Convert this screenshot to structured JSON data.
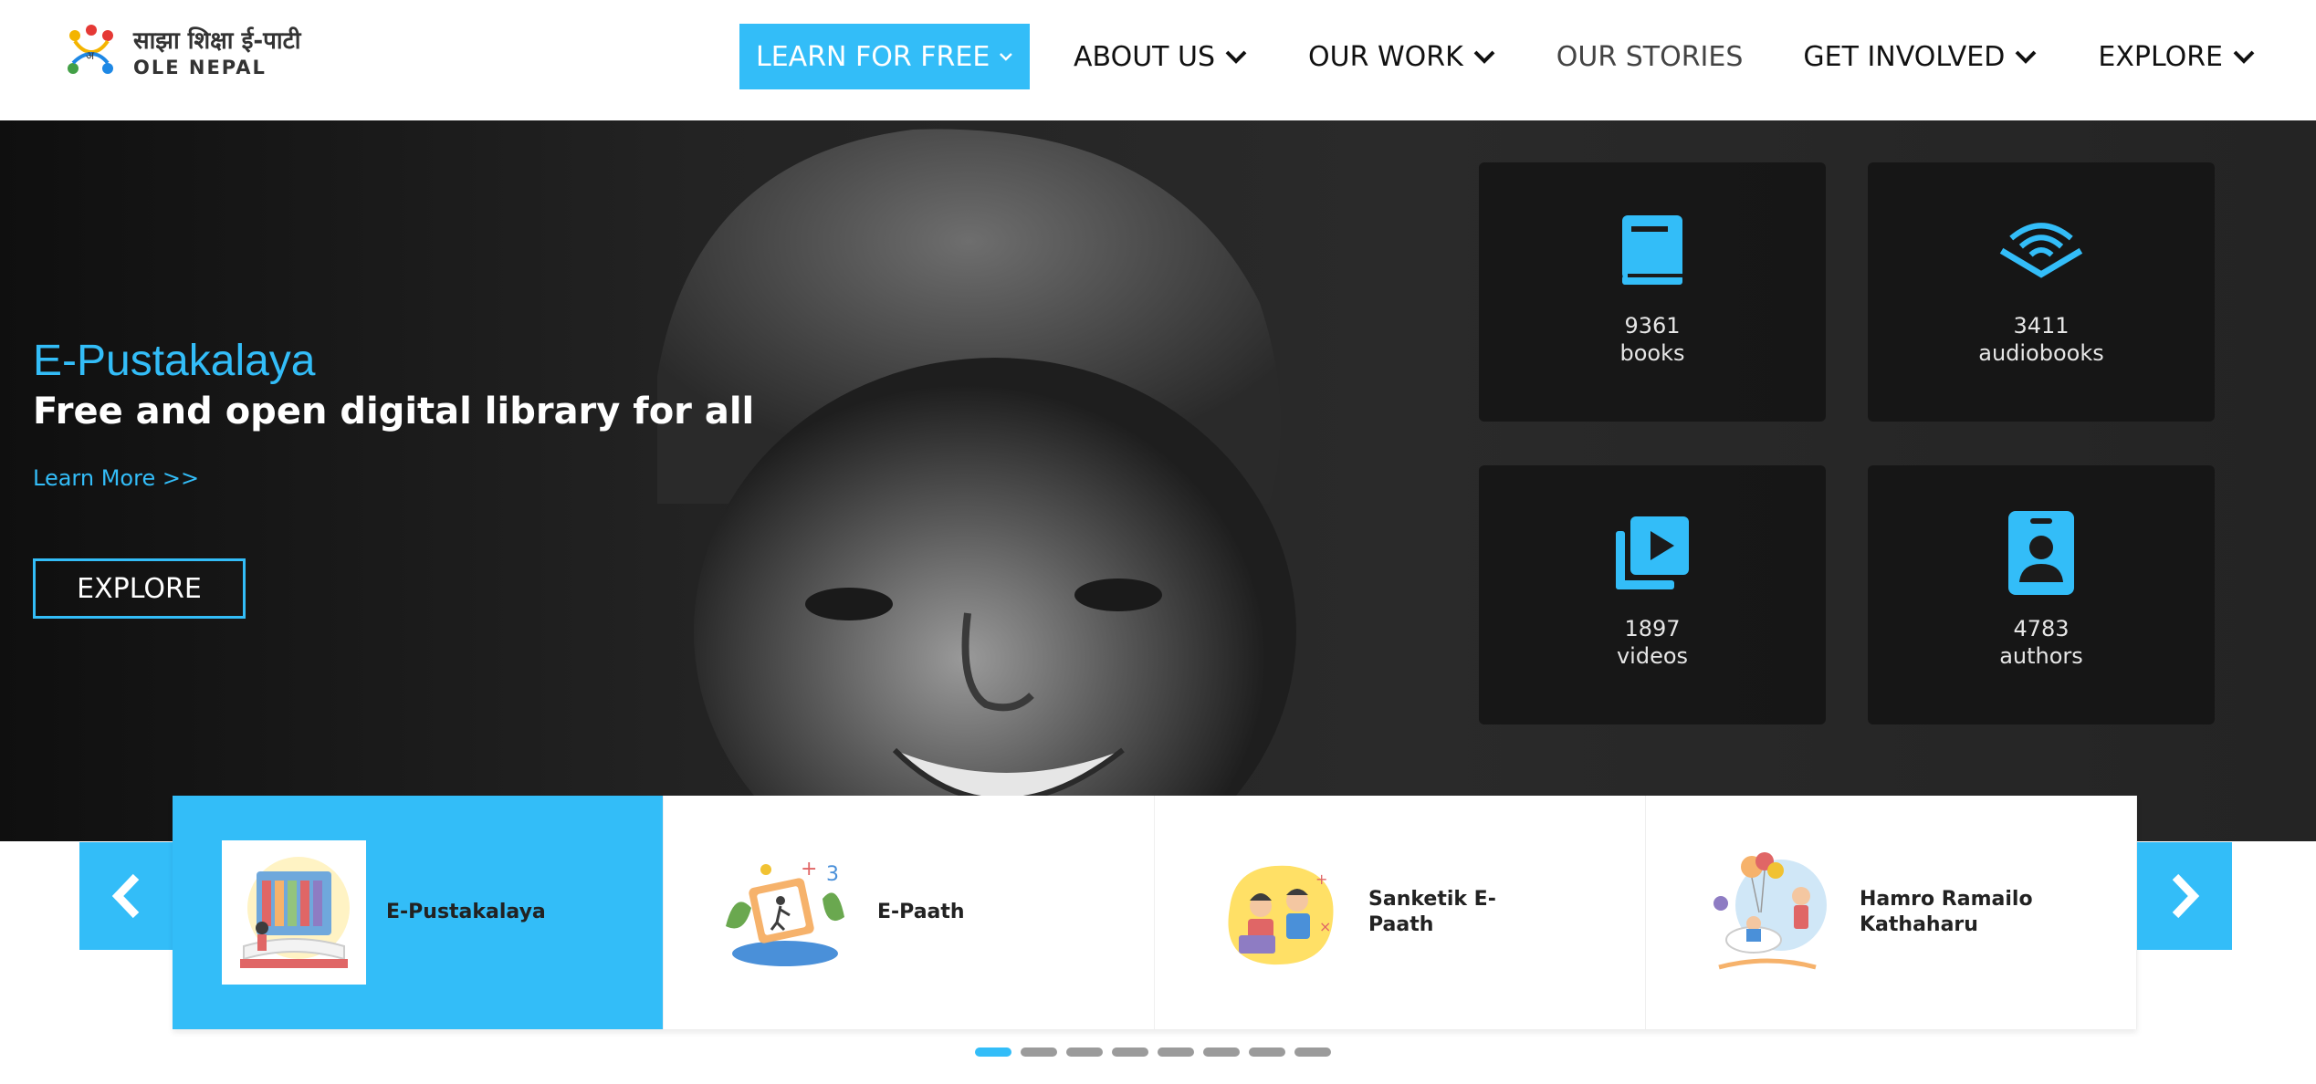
{
  "brand": {
    "name_devanagari": "साझा शिक्षा ई-पाटी",
    "name_latin": "OLE NEPAL",
    "accent": "#33bdf8"
  },
  "nav": {
    "items": [
      {
        "label": "LEARN FOR FREE",
        "has_dropdown": true,
        "active": true
      },
      {
        "label": "ABOUT US",
        "has_dropdown": true
      },
      {
        "label": "OUR WORK",
        "has_dropdown": true
      },
      {
        "label": "OUR STORIES",
        "has_dropdown": false
      },
      {
        "label": "GET INVOLVED",
        "has_dropdown": true
      },
      {
        "label": "EXPLORE",
        "has_dropdown": true
      }
    ]
  },
  "hero": {
    "title": "E-Pustakalaya",
    "subtitle": "Free and open digital library for all",
    "link": "Learn More >>",
    "button": "EXPLORE",
    "stats": [
      {
        "icon": "book-icon",
        "value": "9361",
        "label": "books"
      },
      {
        "icon": "audiobook-icon",
        "value": "3411",
        "label": "audiobooks"
      },
      {
        "icon": "video-icon",
        "value": "1897",
        "label": "videos"
      },
      {
        "icon": "author-icon",
        "value": "4783",
        "label": "authors"
      }
    ]
  },
  "carousel": {
    "prev_icon": "chevron-left-icon",
    "next_icon": "chevron-right-icon",
    "cards": [
      {
        "label": "E-Pustakalaya",
        "active": true
      },
      {
        "label": "E-Paath"
      },
      {
        "label": "Sanketik E-Paath"
      },
      {
        "label": "Hamro Ramailo Kathaharu"
      }
    ],
    "page_count": 8,
    "active_page": 1
  }
}
